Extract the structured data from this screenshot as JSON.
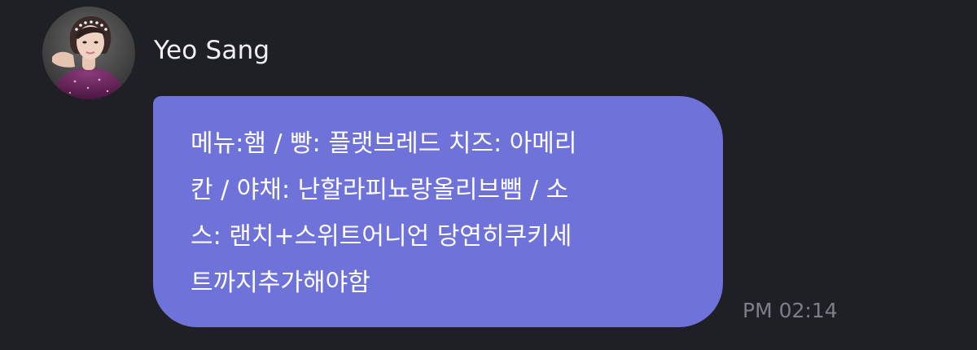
{
  "chat": {
    "sender": {
      "name": "Yeo Sang",
      "avatar_icon": "profile-photo"
    },
    "message": {
      "text": "메뉴:햄 / 빵: 플랫브레드 치즈: 아메리\n칸 / 야채: 난할라피뇨랑올리브뺌 / 소\n스: 랜치+스위트어니언 당연히쿠키세\n트까지추가해야함",
      "time": "PM 02:14"
    }
  },
  "colors": {
    "background": "#1f1f26",
    "bubble": "#6e72d9",
    "text": "#ffffff",
    "timestamp": "#7e7e8a"
  }
}
